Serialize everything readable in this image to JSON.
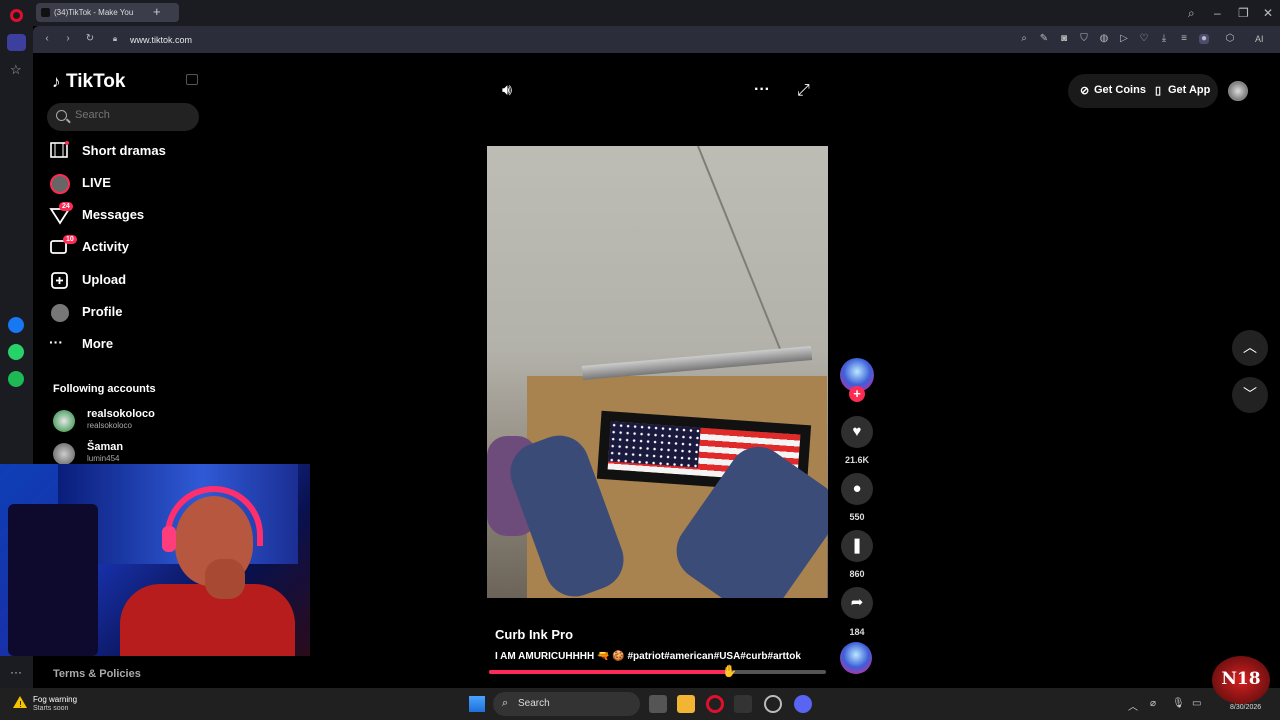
{
  "browser": {
    "tab_title": "(34)TikTok - Make You",
    "url": "www.tiktok.com",
    "ai_label": "AI"
  },
  "sidebar": {
    "logo": "TikTok",
    "search_placeholder": "Search",
    "nav": [
      {
        "label": "Short dramas",
        "icon": "film-icon"
      },
      {
        "label": "LIVE",
        "icon": "live-avatar-icon"
      },
      {
        "label": "Messages",
        "icon": "messages-icon",
        "badge": "24"
      },
      {
        "label": "Activity",
        "icon": "activity-icon",
        "badge": "10"
      },
      {
        "label": "Upload",
        "icon": "upload-icon"
      },
      {
        "label": "Profile",
        "icon": "profile-avatar-icon"
      },
      {
        "label": "More",
        "icon": "more-icon"
      }
    ],
    "following_header": "Following accounts",
    "accounts": [
      {
        "name": "realsokoloco",
        "handle": "realsokoloco"
      },
      {
        "name": "Šaman",
        "handle": "lumin454"
      }
    ],
    "terms": "Terms & Policies"
  },
  "video": {
    "author": "Curb Ink Pro",
    "caption": "I AM AMURICUHHHH 🔫 🍪 #patriot#american#USA#curb#arttok",
    "progress": 0.72
  },
  "actions": {
    "likes": "21.6K",
    "comments": "550",
    "saves": "860",
    "shares": "184"
  },
  "topbar": {
    "get_coins": "Get Coins",
    "get_app": "Get App"
  },
  "taskbar": {
    "weather_title": "Fog warning",
    "weather_sub": "Starts soon",
    "search": "Search",
    "date": "8/30/2026"
  },
  "overlay": {
    "logo_text": "N18"
  }
}
